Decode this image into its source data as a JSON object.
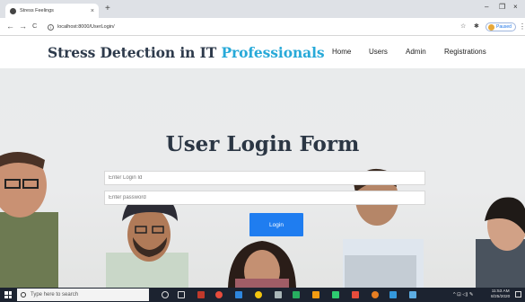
{
  "browser": {
    "tab_title": "Stress Feelings",
    "tab_close": "×",
    "new_tab": "+",
    "url": "localhost:8000/UserLogin/",
    "profile_label": "Paused",
    "back": "←",
    "forward": "→",
    "reload": "C",
    "minimize": "–",
    "restore": "❐",
    "close": "×",
    "star": "☆",
    "extension": "✱",
    "menu": "⋮"
  },
  "site": {
    "brand_main": "Stress Detection in IT",
    "brand_accent": "Professionals",
    "nav": [
      "Home",
      "Users",
      "Admin",
      "Registrations"
    ]
  },
  "login": {
    "title": "User Login Form",
    "login_id_placeholder": "Enter Login Id",
    "password_placeholder": "Enter password",
    "button_label": "Login"
  },
  "taskbar": {
    "search_placeholder": "Type here to search",
    "time": "11:53 AM",
    "date": "8/25/2020",
    "tray_icons": "^ ⊡ ◁) ✎"
  },
  "colors": {
    "brand": "#2d3a4b",
    "accent": "#27a9d8",
    "button": "#1f7df0",
    "taskbar": "#1c2330"
  }
}
